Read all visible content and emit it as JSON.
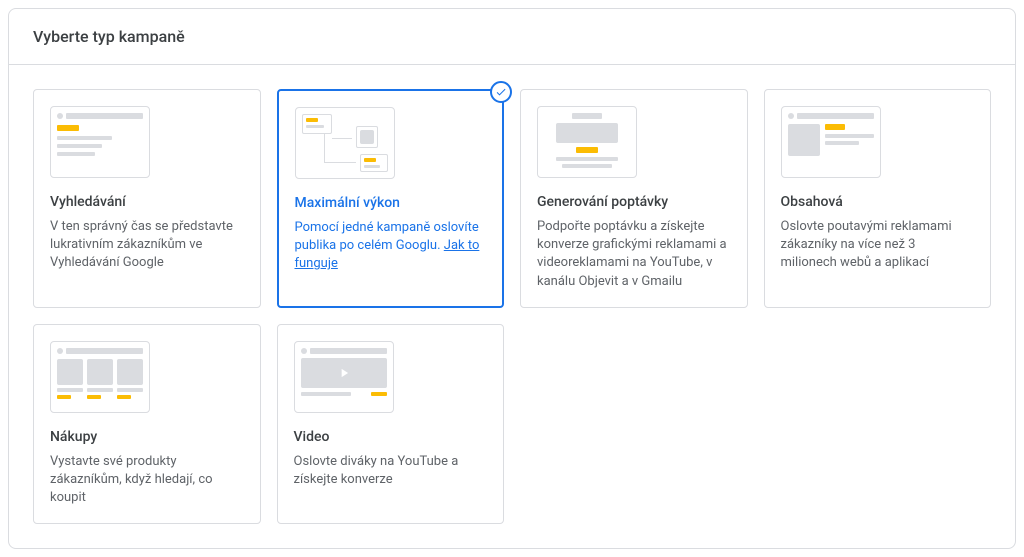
{
  "header": {
    "title": "Vyberte typ kampaně"
  },
  "cards": {
    "search": {
      "title": "Vyhledávání",
      "desc": "V ten správný čas se představte lukrativním zákazníkům ve Vyhledávání Google"
    },
    "pmax": {
      "title": "Maximální výkon",
      "desc": "Pomocí jedné kampaně oslovíte publika po celém Googlu. ",
      "link": "Jak to funguje"
    },
    "demand": {
      "title": "Generování poptávky",
      "desc": "Podpořte poptávku a získejte konverze grafickými reklamami a videoreklamami na YouTube, v kanálu Objevit a v Gmailu"
    },
    "display": {
      "title": "Obsahová",
      "desc": "Oslovte poutavými reklamami zákazníky na více než 3 milionech webů a aplikací"
    },
    "shopping": {
      "title": "Nákupy",
      "desc": "Vystavte své produkty zákazníkům, když hledají, co koupit"
    },
    "video": {
      "title": "Video",
      "desc": "Oslovte diváky na YouTube a získejte konverze"
    }
  }
}
